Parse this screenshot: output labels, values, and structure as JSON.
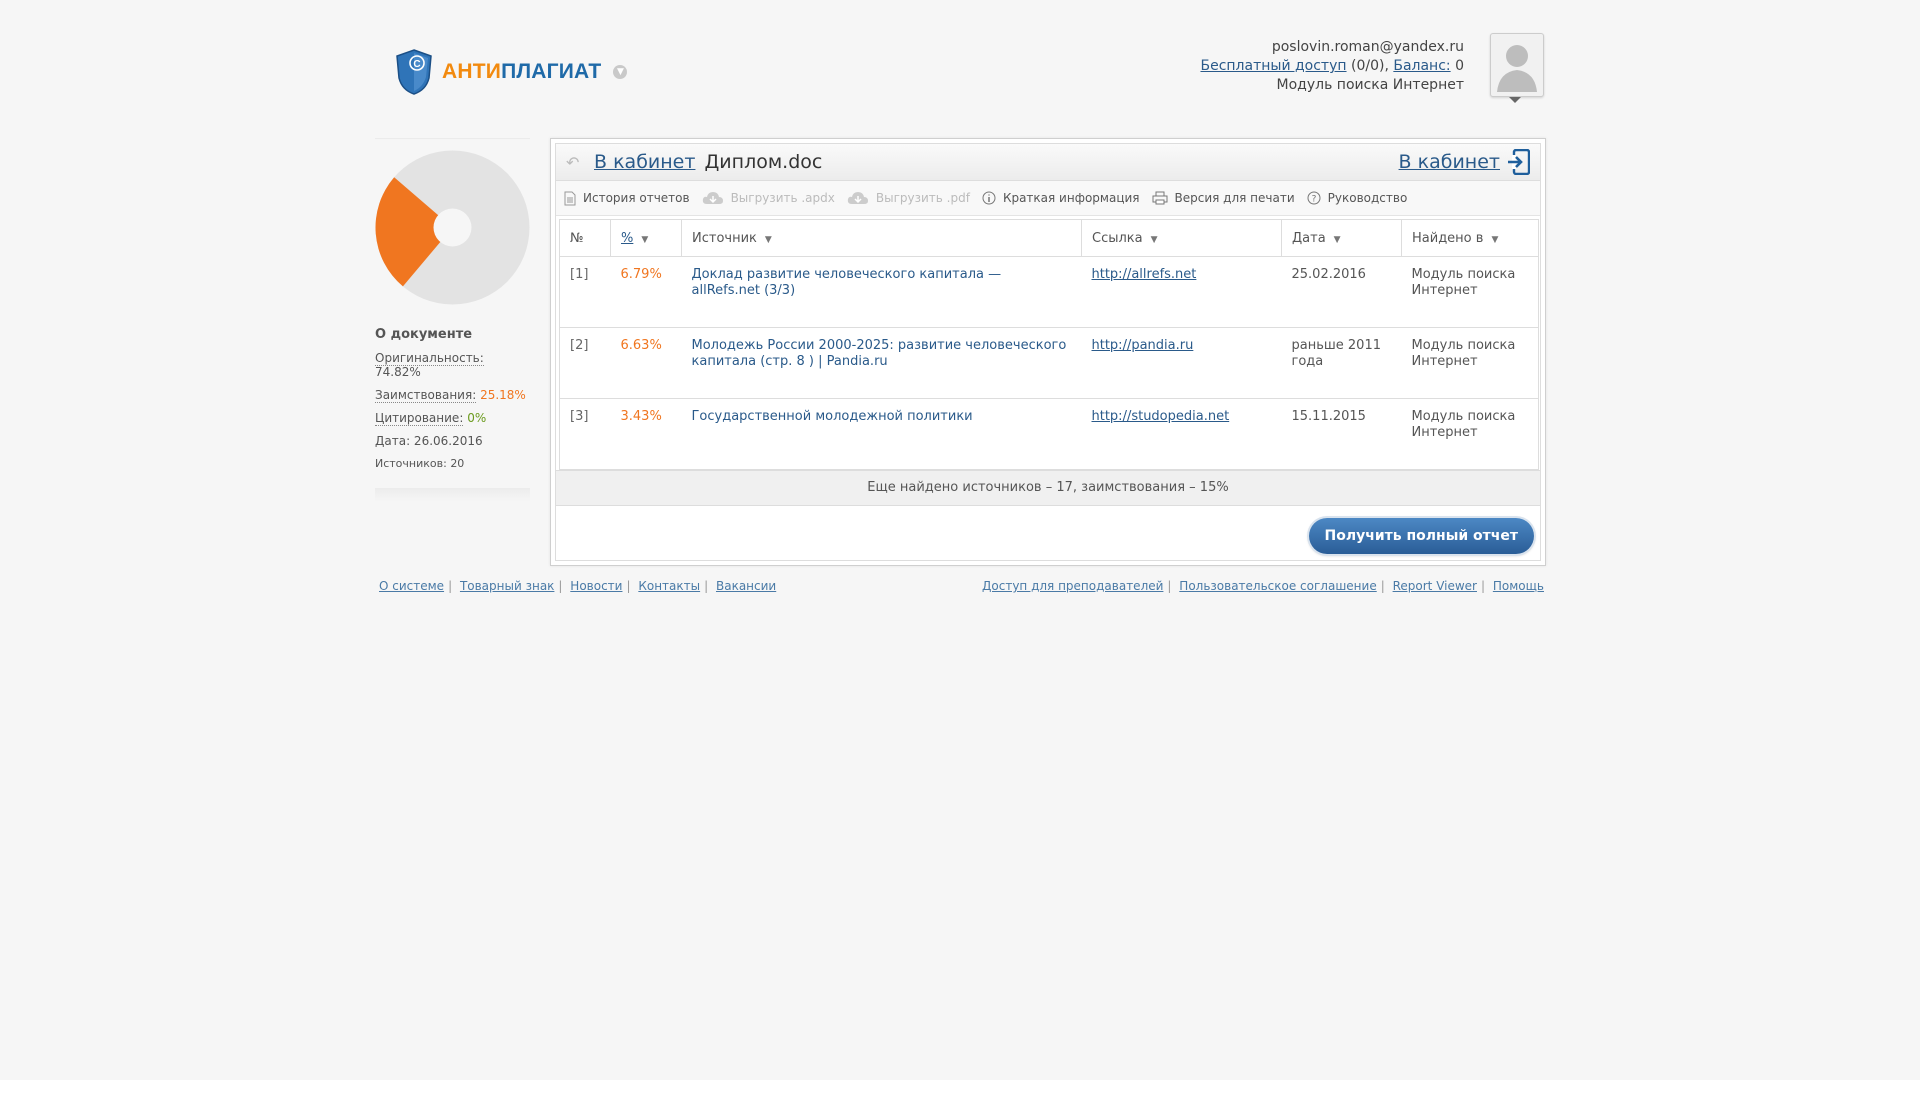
{
  "header": {
    "logo": {
      "part1": "АНТИ",
      "part2": "ПЛАГИАТ"
    },
    "user_email": "poslovin.roman@yandex.ru",
    "free_access_label": "Бесплатный доступ",
    "free_access_count": "(0/0),",
    "balance_label": "Баланс:",
    "balance_value": "0",
    "module_label": "Модуль поиска Интернет"
  },
  "sidebar": {
    "about_title": "О документе",
    "originality_label": "Оригинальность:",
    "originality_value": "74.82%",
    "borrowing_label": "Заимствования:",
    "borrowing_value": "25.18%",
    "citation_label": "Цитирование:",
    "citation_value": "0%",
    "date_text": "Дата: 26.06.2016",
    "sources_text": "Источников: 20",
    "pie": {
      "originality": 74.82,
      "borrowing": 25.18,
      "citation": 0
    }
  },
  "panel": {
    "cabinet_link": "В кабинет",
    "doc_name": "Диплом.doc",
    "cabinet_link_right": "В кабинет",
    "toolbar": {
      "history": "История отчетов",
      "export_apdx": "Выгрузить .apdx",
      "export_pdf": "Выгрузить .pdf",
      "brief_info": "Краткая информация",
      "print_version": "Версия для печати",
      "guide": "Руководство"
    },
    "columns": {
      "num": "№",
      "pct": "%",
      "source": "Источник",
      "link": "Ссылка",
      "date": "Дата",
      "found": "Найдено в"
    },
    "rows": [
      {
        "num": "[1]",
        "pct": "6.79%",
        "source": "Доклад развитие человеческого капитала — allRefs.net (3/3)",
        "link": "http://allrefs.net",
        "date": "25.02.2016",
        "found": "Модуль поиска Интернет"
      },
      {
        "num": "[2]",
        "pct": "6.63%",
        "source": "Молодежь России 2000-2025: развитие человеческого капитала (стр. 8 ) | Pandia.ru",
        "link": "http://pandia.ru",
        "date": "раньше 2011 года",
        "found": "Модуль поиска Интернет"
      },
      {
        "num": "[3]",
        "pct": "3.43%",
        "source": "Государственной молодежной политики",
        "link": "http://studopedia.net",
        "date": "15.11.2015",
        "found": "Модуль поиска Интернет"
      }
    ],
    "more_text": "Еще найдено источников – 17, заимствования – 15%",
    "full_report_button": "Получить полный отчет"
  },
  "footer": {
    "left": [
      "О системе",
      "Товарный знак",
      "Новости",
      "Контакты",
      "Вакансии"
    ],
    "right": [
      "Доступ для преподавателей",
      "Пользовательское соглашение",
      "Report Viewer",
      "Помощь"
    ]
  },
  "colors": {
    "orange": "#f07620",
    "blue": "#2a5a8a",
    "pie_gray": "#e3e3e3"
  }
}
